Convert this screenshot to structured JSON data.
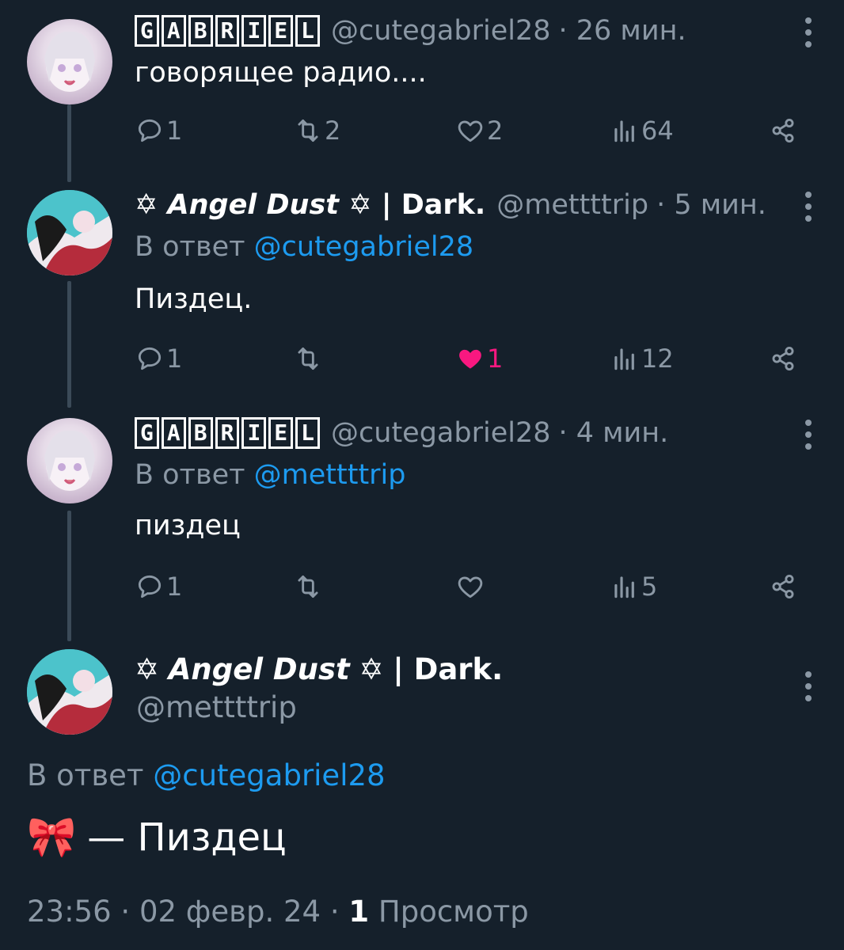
{
  "tweets": [
    {
      "name_letters": [
        "G",
        "A",
        "B",
        "R",
        "I",
        "E",
        "L"
      ],
      "handle": "@cutegabriel28",
      "time": "· 26 мин.",
      "reply_prefix": "",
      "reply_to": "",
      "text": "говорящее радио....",
      "reply_count": "1",
      "retweet_count": "2",
      "like_count": "2",
      "liked": false,
      "view_count": "64"
    },
    {
      "name_prefix": "✡",
      "name_main": "Angel Dust",
      "name_suffix": "✡",
      "name_tail": "| Dark.",
      "handle": "@mettttrip",
      "time": "· 5 мин.",
      "reply_prefix": "В ответ",
      "reply_to": "@cutegabriel28",
      "text": "Пиздец.",
      "reply_count": "1",
      "retweet_count": "",
      "like_count": "1",
      "liked": true,
      "view_count": "12"
    },
    {
      "name_letters": [
        "G",
        "A",
        "B",
        "R",
        "I",
        "E",
        "L"
      ],
      "handle": "@cutegabriel28",
      "time": "· 4 мин.",
      "reply_prefix": "В ответ",
      "reply_to": "@mettttrip",
      "text": "пиздец",
      "reply_count": "1",
      "retweet_count": "",
      "like_count": "",
      "liked": false,
      "view_count": "5"
    }
  ],
  "main": {
    "name_prefix": "✡",
    "name_main": "Angel Dust",
    "name_suffix": "✡",
    "name_tail": "| Dark.",
    "handle": "@mettttrip",
    "reply_prefix": "В ответ",
    "reply_to": "@cutegabriel28",
    "emoji": "🎀",
    "text": "— Пиздец",
    "time": "23:56",
    "date": "02 февр. 24",
    "sep": "·",
    "views_count": "1",
    "views_label": "Просмотр"
  },
  "colors": {
    "background": "#15202b",
    "secondary_text": "#8b98a5",
    "link": "#1d9bf0",
    "like_active": "#f91880"
  }
}
